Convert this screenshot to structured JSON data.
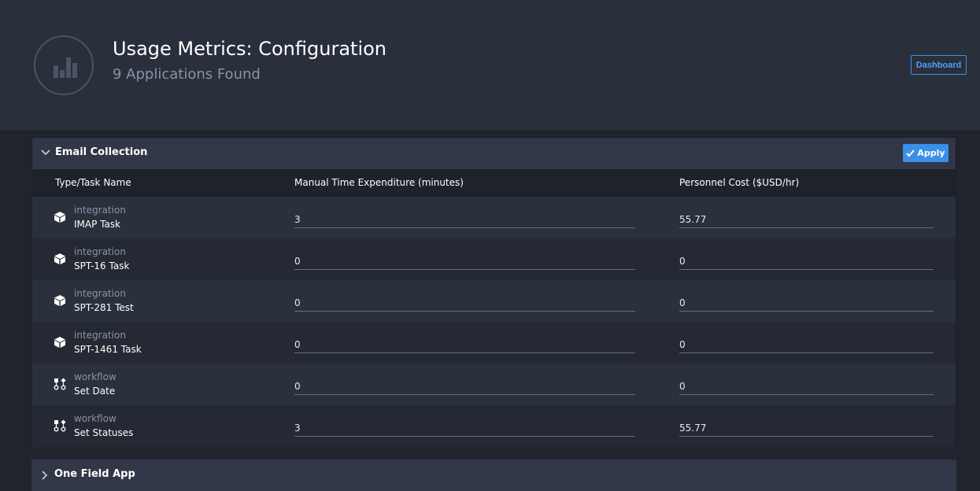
{
  "header": {
    "title": "Usage Metrics: Configuration",
    "subtitle": "9 Applications Found",
    "dashboard_label": "Dashboard"
  },
  "panel": {
    "title": "Email Collection",
    "apply_label": "Apply",
    "columns": [
      "Type/Task Name",
      "Manual Time Expenditure (minutes)",
      "Personnel Cost ($USD/hr)"
    ],
    "rows": [
      {
        "type": "integration",
        "name": "IMAP Task",
        "time": "3",
        "cost": "55.77",
        "icon": "cube-icon"
      },
      {
        "type": "integration",
        "name": "SPT-16 Task",
        "time": "0",
        "cost": "0",
        "icon": "cube-icon"
      },
      {
        "type": "integration",
        "name": "SPT-281 Test",
        "time": "0",
        "cost": "0",
        "icon": "cube-icon"
      },
      {
        "type": "integration",
        "name": "SPT-1461 Task",
        "time": "0",
        "cost": "0",
        "icon": "cube-icon"
      },
      {
        "type": "workflow",
        "name": "Set Date",
        "time": "0",
        "cost": "0",
        "icon": "workflow-icon"
      },
      {
        "type": "workflow",
        "name": "Set Statuses",
        "time": "3",
        "cost": "55.77",
        "icon": "workflow-icon"
      }
    ]
  },
  "panel2": {
    "title": "One Field App"
  },
  "colors": {
    "accent": "#3a8fe8",
    "background": "#20242d"
  }
}
